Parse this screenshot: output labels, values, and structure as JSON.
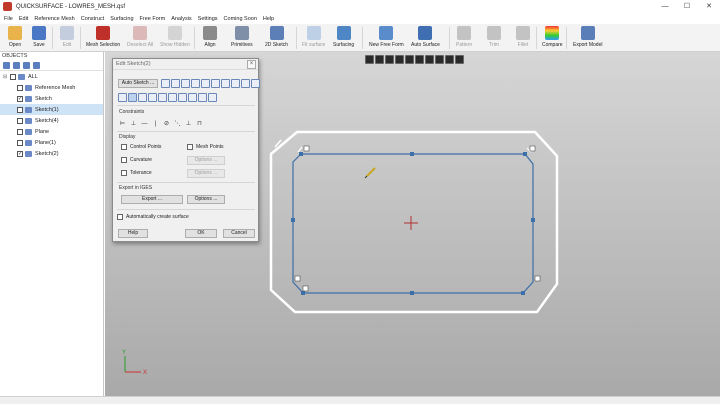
{
  "window": {
    "title": "QUICKSURFACE - LOWRES_MESH.qsf",
    "controls": [
      "—",
      "☐",
      "✕"
    ]
  },
  "menu": [
    "File",
    "Edit",
    "Reference Mesh",
    "Construct",
    "Surfacing",
    "Free Form",
    "Analysis",
    "Settings",
    "Coming Soon",
    "Help"
  ],
  "ribbon": {
    "open": "Open",
    "save": "Save",
    "edit": "Edit",
    "mesh_selection": "Mesh Selection",
    "deselect_all": "Deselect All",
    "show_hidden": "Show Hidden",
    "align": "Align",
    "primitives": "Primitives",
    "sketch2d": "2D Sketch",
    "fit_surface": "Fit surface",
    "surfacing": "Surfacing",
    "new_free_form": "New Free Form",
    "auto_surface": "Auto Surface",
    "pattern": "Pattern",
    "trim": "Trim",
    "fillet": "Fillet",
    "compare": "Compare",
    "export_model": "Export Model"
  },
  "objects": {
    "title": "OBJECTS",
    "items": [
      {
        "label": "ALL",
        "checked": false,
        "expander": "⊟"
      },
      {
        "label": "Reference Mesh",
        "checked": false,
        "expander": ""
      },
      {
        "label": "Sketch",
        "checked": true,
        "expander": ""
      },
      {
        "label": "Sketch(1)",
        "checked": false,
        "expander": "",
        "selected": true
      },
      {
        "label": "Sketch(4)",
        "checked": false,
        "expander": ""
      },
      {
        "label": "Plane",
        "checked": false,
        "expander": ""
      },
      {
        "label": "Plane(1)",
        "checked": false,
        "expander": ""
      },
      {
        "label": "Sketch(2)",
        "checked": true,
        "expander": ""
      }
    ]
  },
  "dialog": {
    "title": "Edit Sketch(2)",
    "auto_sketch": "Auto Sketch ...",
    "constraints_label": "Constraints",
    "constraint_glyphs": [
      "⊨",
      "⊥",
      "—",
      "|",
      "⊘",
      "⋱",
      "⊥",
      "⊓"
    ],
    "display_label": "Display",
    "control_points": "Control Points",
    "mesh_points": "Mesh Points",
    "curvature": "Curvature",
    "tolerance": "Tolerance",
    "options1": "Options ...",
    "options2": "Options ...",
    "export_label": "Export in IGES",
    "export": "Export ...",
    "options3": "Options ...",
    "auto_create": "Automatically create surface",
    "help": "Help",
    "ok": "OK",
    "cancel": "Cancel"
  },
  "axes": {
    "x": "X",
    "y": "Y"
  },
  "colors": {
    "sketch_line": "#3d6fa8",
    "mesh_outline": "#ffffff",
    "viewport_top": "#d6d6d6",
    "viewport_bottom": "#a9a9a9"
  }
}
